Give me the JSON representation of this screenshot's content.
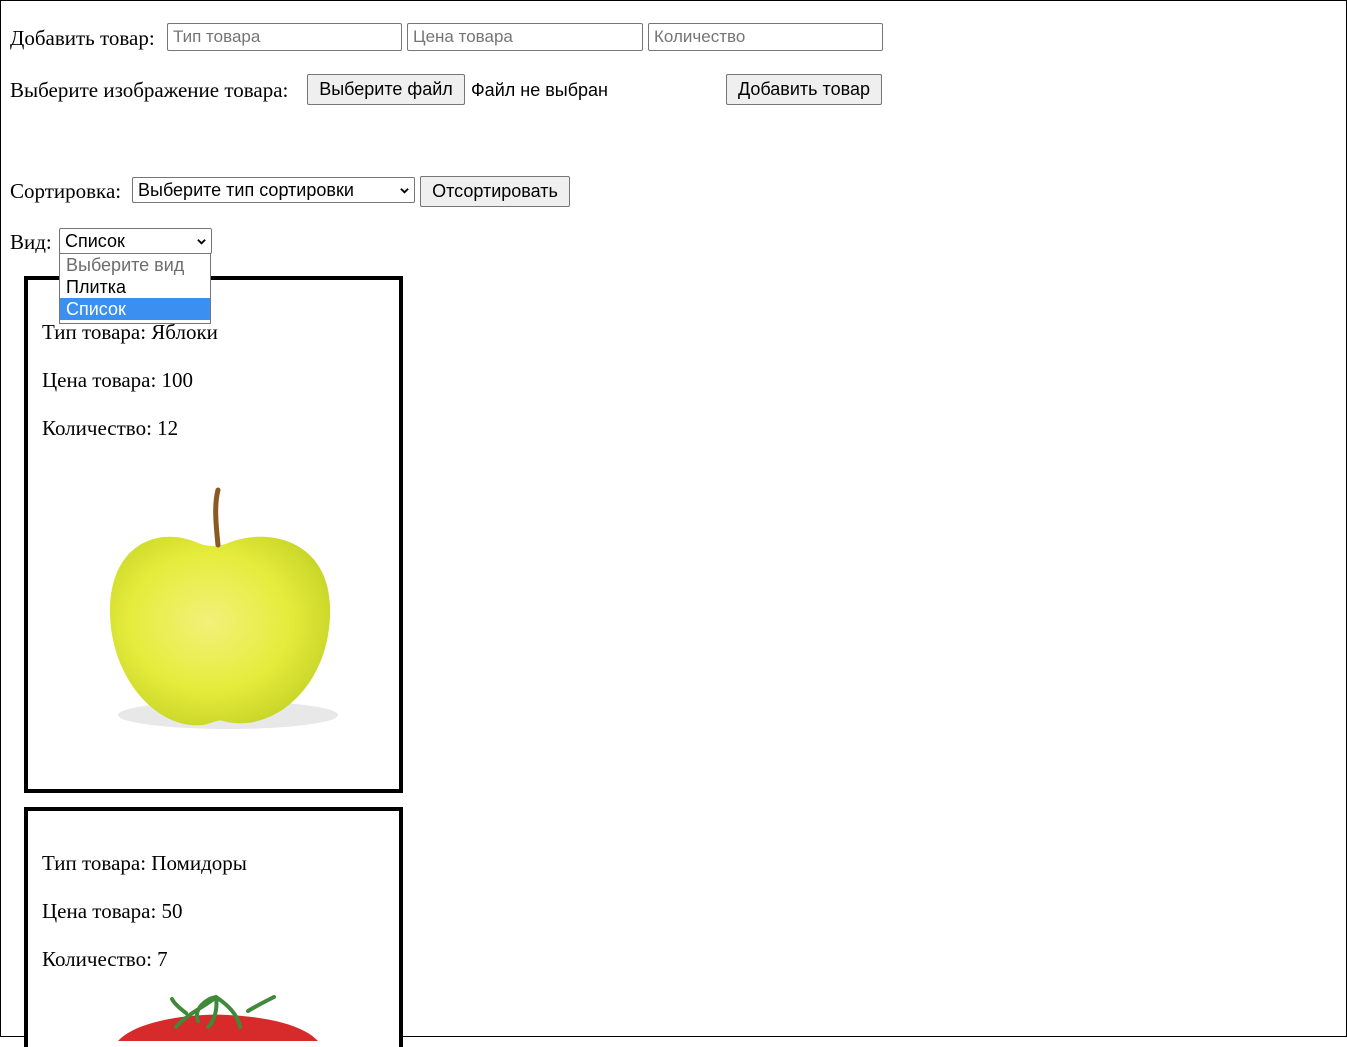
{
  "add_form": {
    "label": "Добавить товар:",
    "type_placeholder": "Тип товара",
    "price_placeholder": "Цена товара",
    "qty_placeholder": "Количество",
    "image_label": "Выберите изображение товара:",
    "file_button": "Выберите файл",
    "file_status": "Файл не выбран",
    "submit_button": "Добавить товар"
  },
  "sort": {
    "label": "Сортировка:",
    "selected": "Выберите тип сортировки",
    "button": "Отсортировать"
  },
  "view": {
    "label": "Вид:",
    "selected": "Список",
    "options": [
      "Выберите вид",
      "Плитка",
      "Список"
    ]
  },
  "products": [
    {
      "type_label": "Тип товара: Яблоки",
      "price_label": "Цена товара: 100",
      "qty_label": "Количество: 12",
      "image": "apple"
    },
    {
      "type_label": "Тип товара: Помидоры",
      "price_label": "Цена товара: 50",
      "qty_label": "Количество: 7",
      "image": "tomato"
    }
  ],
  "colors": {
    "highlight": "#3b8ff0",
    "apple": "#e6ec3c",
    "tomato": "#d72a2a"
  }
}
